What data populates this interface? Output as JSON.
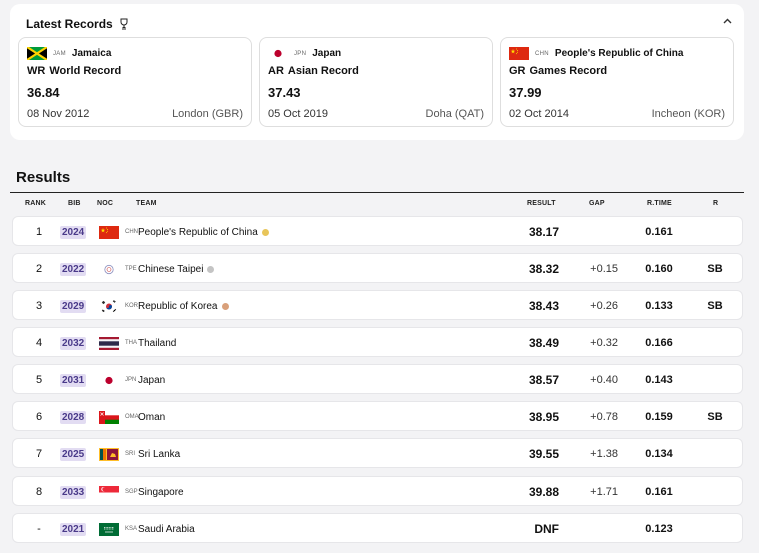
{
  "records": {
    "title": "Latest Records",
    "collapse_icon": "chevron-up-icon",
    "cards": [
      {
        "flag": "JAM",
        "code": "JAM",
        "country": "Jamaica",
        "abbr": "WR",
        "type": "World Record",
        "value": "36.84",
        "date": "08 Nov 2012",
        "venue": "London (GBR)"
      },
      {
        "flag": "JPN",
        "code": "JPN",
        "country": "Japan",
        "abbr": "AR",
        "type": "Asian Record",
        "value": "37.43",
        "date": "05 Oct 2019",
        "venue": "Doha (QAT)"
      },
      {
        "flag": "CHN",
        "code": "CHN",
        "country": "People's Republic of China",
        "abbr": "GR",
        "type": "Games Record",
        "value": "37.99",
        "date": "02 Oct 2014",
        "venue": "Incheon (KOR)"
      }
    ]
  },
  "results": {
    "title": "Results",
    "headers": {
      "rank": "RANK",
      "bib": "BIB",
      "noc": "NOC",
      "team": "TEAM",
      "result": "RESULT",
      "gap": "GAP",
      "rtime": "R.TIME",
      "record": "R"
    },
    "rows": [
      {
        "rank": "1",
        "bib": "2024",
        "flag": "CHN",
        "code": "CHN",
        "team": "People's Republic of China",
        "medal": "gold",
        "result": "38.17",
        "gap": "",
        "rtime": "0.161",
        "record": ""
      },
      {
        "rank": "2",
        "bib": "2022",
        "flag": "TPE",
        "code": "TPE",
        "team": "Chinese Taipei",
        "medal": "silver",
        "result": "38.32",
        "gap": "+0.15",
        "rtime": "0.160",
        "record": "SB"
      },
      {
        "rank": "3",
        "bib": "2029",
        "flag": "KOR",
        "code": "KOR",
        "team": "Republic of Korea",
        "medal": "bronze",
        "result": "38.43",
        "gap": "+0.26",
        "rtime": "0.133",
        "record": "SB"
      },
      {
        "rank": "4",
        "bib": "2032",
        "flag": "THA",
        "code": "THA",
        "team": "Thailand",
        "medal": "",
        "result": "38.49",
        "gap": "+0.32",
        "rtime": "0.166",
        "record": ""
      },
      {
        "rank": "5",
        "bib": "2031",
        "flag": "JPN",
        "code": "JPN",
        "team": "Japan",
        "medal": "",
        "result": "38.57",
        "gap": "+0.40",
        "rtime": "0.143",
        "record": ""
      },
      {
        "rank": "6",
        "bib": "2028",
        "flag": "OMA",
        "code": "OMA",
        "team": "Oman",
        "medal": "",
        "result": "38.95",
        "gap": "+0.78",
        "rtime": "0.159",
        "record": "SB"
      },
      {
        "rank": "7",
        "bib": "2025",
        "flag": "SRI",
        "code": "SRI",
        "team": "Sri Lanka",
        "medal": "",
        "result": "39.55",
        "gap": "+1.38",
        "rtime": "0.134",
        "record": ""
      },
      {
        "rank": "8",
        "bib": "2033",
        "flag": "SGP",
        "code": "SGP",
        "team": "Singapore",
        "medal": "",
        "result": "39.88",
        "gap": "+1.71",
        "rtime": "0.161",
        "record": ""
      },
      {
        "rank": "-",
        "bib": "2021",
        "flag": "KSA",
        "code": "KSA",
        "team": "Saudi Arabia",
        "medal": "",
        "result": "DNF",
        "gap": "",
        "rtime": "0.123",
        "record": ""
      }
    ]
  },
  "colors": {
    "medal_gold": "#e8c55a",
    "medal_silver": "#c4c4c4",
    "medal_bronze": "#d9a07a",
    "bib_bg": "#e2dcf2"
  }
}
